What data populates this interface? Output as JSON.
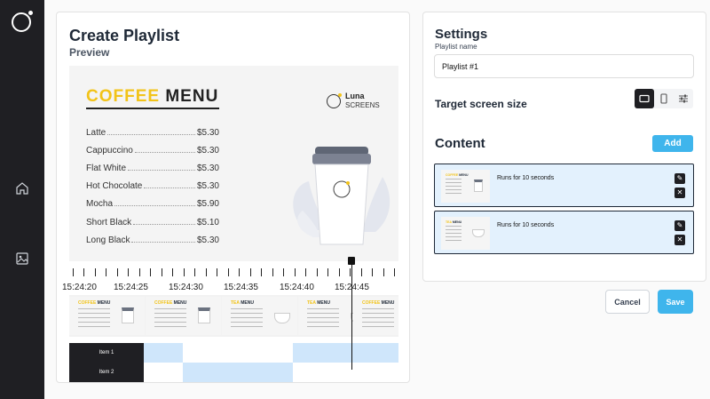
{
  "page": {
    "title": "Create Playlist",
    "preview_label": "Preview"
  },
  "sidebar": {
    "items": [
      {
        "icon": "home-icon"
      },
      {
        "icon": "image-icon"
      }
    ]
  },
  "preview": {
    "menu_title_accent": "COFFEE",
    "menu_title_rest": " MENU",
    "brand_name": "Luna",
    "brand_sub": "SCREENS",
    "items": [
      {
        "name": "Latte",
        "price": "$5.30"
      },
      {
        "name": "Cappuccino",
        "price": "$5.30"
      },
      {
        "name": "Flat White",
        "price": "$5.30"
      },
      {
        "name": "Hot Chocolate",
        "price": "$5.30"
      },
      {
        "name": "Mocha",
        "price": "$5.90"
      },
      {
        "name": "Short Black",
        "price": "$5.10"
      },
      {
        "name": "Long Black",
        "price": "$5.30"
      }
    ]
  },
  "timeline": {
    "labels": [
      "15:24:20",
      "15:24:25",
      "15:24:30",
      "15:24:35",
      "15:24:40",
      "15:24:45"
    ],
    "thumbs": [
      {
        "accent": "COFFEE",
        "rest": " MENU",
        "kind": "cup"
      },
      {
        "accent": "COFFEE",
        "rest": " MENU",
        "kind": "cup"
      },
      {
        "accent": "TEA",
        "rest": " MENU",
        "kind": "tea"
      },
      {
        "accent": "TEA",
        "rest": " MENU",
        "kind": "tea"
      },
      {
        "accent": "COFFEE",
        "rest": " MENU",
        "kind": "cup"
      }
    ],
    "tracks": [
      {
        "label": "Item 1"
      },
      {
        "label": "Item 2"
      }
    ]
  },
  "settings": {
    "title": "Settings",
    "playlist_name_label": "Playlist name",
    "playlist_name_value": "Playlist #1",
    "target_label": "Target screen size",
    "content_label": "Content",
    "add_label": "Add",
    "items": [
      {
        "text": "Runs for 10 seconds",
        "accent": "COFFEE",
        "rest": " MENU",
        "kind": "cup"
      },
      {
        "text": "Runs for 10 seconds",
        "accent": "TEA",
        "rest": " MENU",
        "kind": "tea"
      }
    ]
  },
  "actions": {
    "cancel_label": "Cancel",
    "save_label": "Save"
  },
  "colors": {
    "accent": "#3fb5ec",
    "brand_yellow": "#f2c318",
    "sidebar": "#1f1f23",
    "segment": "#cfe6fb"
  }
}
